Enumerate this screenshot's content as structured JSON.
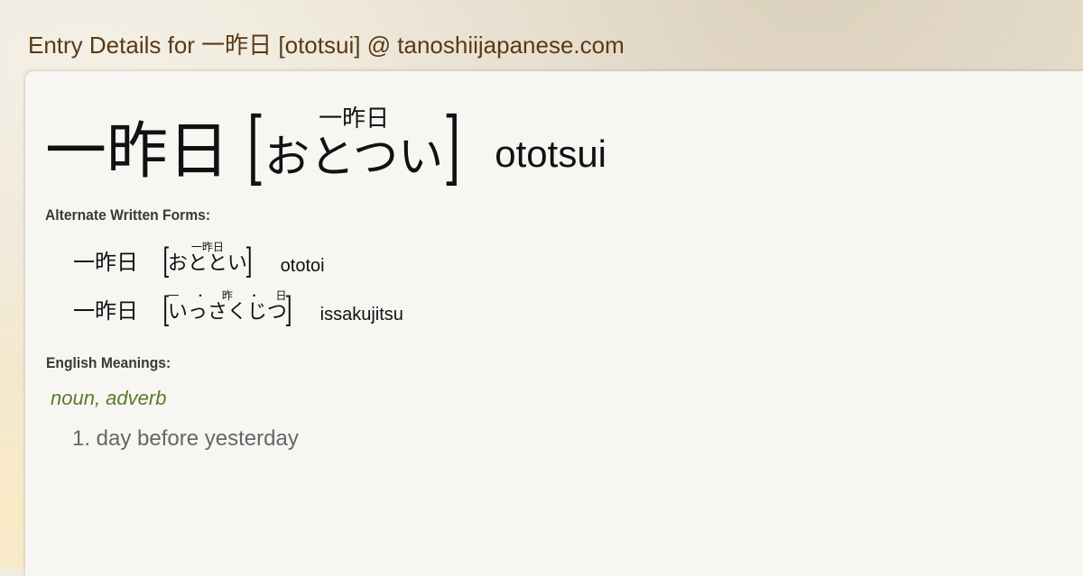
{
  "site_title": "Entry Details for 一昨日 [ototsui] @ tanoshiijapanese.com",
  "entry": {
    "kanji": "一昨日",
    "furigana": "一昨日",
    "kana": "おとつい",
    "romaji": "ototsui",
    "bracket_open": "[",
    "bracket_close": "]"
  },
  "alternate_forms": {
    "label": "Alternate Written Forms:",
    "items": [
      {
        "kanji": "一昨日",
        "furigana": "一昨日",
        "kana": "おととい",
        "romaji": "ototoi"
      },
      {
        "kanji": "一昨日",
        "furigana": "一 ・ 昨 ・ 日",
        "kana": "いっさくじつ",
        "romaji": "issakujitsu"
      }
    ]
  },
  "meanings": {
    "label": "English Meanings:",
    "part_of_speech": "noun, adverb",
    "definitions": [
      "1. day before yesterday"
    ]
  }
}
